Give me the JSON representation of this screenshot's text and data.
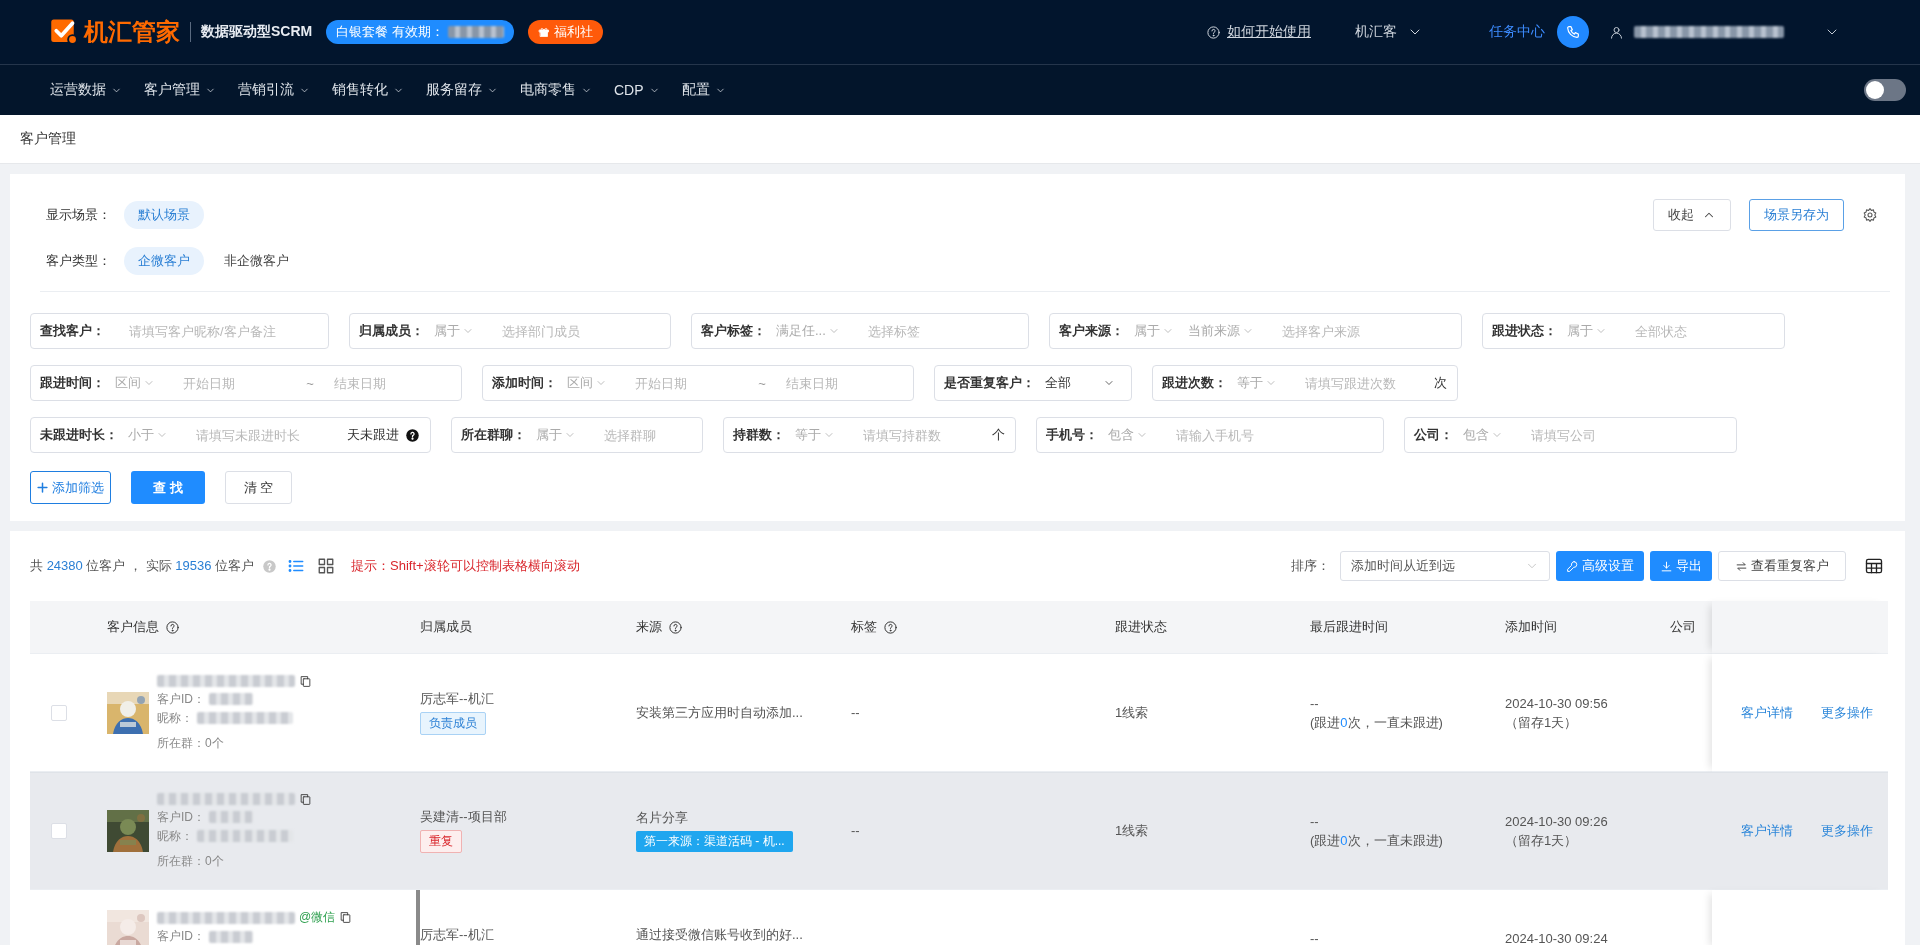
{
  "header": {
    "brand": "机汇管家",
    "product": "数据驱动型SCRM",
    "plan_badge": "白银套餐 有效期：",
    "welfare_badge": "福利社",
    "help_link": "如何开始使用",
    "org_menu": "机汇客",
    "task_center": "任务中心"
  },
  "nav": {
    "items": [
      {
        "label": "运营数据"
      },
      {
        "label": "客户管理"
      },
      {
        "label": "营销引流"
      },
      {
        "label": "销售转化"
      },
      {
        "label": "服务留存"
      },
      {
        "label": "电商零售"
      },
      {
        "label": "CDP"
      },
      {
        "label": "配置"
      }
    ],
    "toggle": {
      "on": false
    }
  },
  "breadcrumb": "客户管理",
  "scene_rows": [
    {
      "label": "显示场景：",
      "options": [
        {
          "label": "默认场景",
          "selected": true
        }
      ]
    },
    {
      "label": "客户类型：",
      "options": [
        {
          "label": "企微客户",
          "selected": true
        },
        {
          "label": "非企微客户",
          "selected": false
        }
      ]
    }
  ],
  "card_buttons": {
    "collapse": "收起",
    "save_scene": "场景另存为"
  },
  "filter_rows": [
    [
      {
        "label": "查找客户：",
        "parts": [
          {
            "kind": "input",
            "placeholder": "请填写客户昵称/客户备注"
          }
        ]
      },
      {
        "label": "归属成员：",
        "parts": [
          {
            "kind": "select",
            "value": "属于",
            "muted": true
          },
          {
            "kind": "input",
            "placeholder": "选择部门成员"
          }
        ]
      },
      {
        "label": "客户标签：",
        "parts": [
          {
            "kind": "select",
            "value": "满足任...",
            "muted": true
          },
          {
            "kind": "input",
            "placeholder": "选择标签"
          }
        ]
      },
      {
        "label": "客户来源：",
        "parts": [
          {
            "kind": "select",
            "value": "属于",
            "muted": true
          },
          {
            "kind": "select",
            "value": "当前来源",
            "muted": true
          },
          {
            "kind": "input",
            "placeholder": "选择客户来源"
          }
        ]
      },
      {
        "label": "跟进状态：",
        "parts": [
          {
            "kind": "select",
            "value": "属于",
            "muted": true
          },
          {
            "kind": "input",
            "placeholder": "全部状态"
          }
        ]
      }
    ],
    [
      {
        "label": "跟进时间：",
        "parts": [
          {
            "kind": "select",
            "value": "区间",
            "muted": true
          },
          {
            "kind": "input",
            "placeholder": "开始日期"
          },
          {
            "kind": "separator",
            "text": "~"
          },
          {
            "kind": "input",
            "placeholder": "结束日期"
          }
        ]
      },
      {
        "label": "添加时间：",
        "parts": [
          {
            "kind": "select",
            "value": "区间",
            "muted": true
          },
          {
            "kind": "input",
            "placeholder": "开始日期"
          },
          {
            "kind": "separator",
            "text": "~"
          },
          {
            "kind": "input",
            "placeholder": "结束日期"
          }
        ]
      },
      {
        "label": "是否重复客户：",
        "parts": [
          {
            "kind": "select",
            "value": "全部",
            "muted": false
          }
        ]
      },
      {
        "label": "跟进次数：",
        "parts": [
          {
            "kind": "select",
            "value": "等于",
            "muted": true
          },
          {
            "kind": "input",
            "placeholder": "请填写跟进次数"
          },
          {
            "kind": "unit",
            "text": "次"
          }
        ]
      }
    ],
    [
      {
        "label": "未跟进时长：",
        "parts": [
          {
            "kind": "select",
            "value": "小于",
            "muted": true
          },
          {
            "kind": "input",
            "placeholder": "请填写未跟进时长"
          },
          {
            "kind": "unit",
            "text": "天未跟进"
          },
          {
            "kind": "help"
          }
        ]
      },
      {
        "label": "所在群聊：",
        "parts": [
          {
            "kind": "select",
            "value": "属于",
            "muted": true
          },
          {
            "kind": "input",
            "placeholder": "选择群聊"
          }
        ]
      },
      {
        "label": "持群数：",
        "parts": [
          {
            "kind": "select",
            "value": "等于",
            "muted": true
          },
          {
            "kind": "input",
            "placeholder": "请填写持群数"
          },
          {
            "kind": "unit",
            "text": "个"
          }
        ]
      },
      {
        "label": "手机号：",
        "parts": [
          {
            "kind": "select",
            "value": "包含",
            "muted": true
          },
          {
            "kind": "input",
            "placeholder": "请输入手机号"
          }
        ]
      },
      {
        "label": "公司：",
        "parts": [
          {
            "kind": "select",
            "value": "包含",
            "muted": true
          },
          {
            "kind": "input",
            "placeholder": "请填写公司"
          }
        ]
      }
    ]
  ],
  "filter_buttons": {
    "add": "添加筛选",
    "search": "查 找",
    "clear": "清 空"
  },
  "summary": {
    "total_prefix": "共 ",
    "total": "24380",
    "total_suffix": " 位客户 ， 实际 ",
    "actual": "19536",
    "actual_suffix": " 位客户",
    "views": [
      {
        "kind": "list",
        "selected": true
      },
      {
        "kind": "grid",
        "selected": false
      }
    ],
    "tip": "提示：Shift+滚轮可以控制表格横向滚动"
  },
  "toolbar": {
    "sort_label": "排序：",
    "sort_value": "添加时间从近到远",
    "buttons": [
      {
        "kind": "advanced",
        "label": "高级设置"
      },
      {
        "kind": "export",
        "label": "导出"
      },
      {
        "kind": "duplicates",
        "label": "查看重复客户"
      }
    ]
  },
  "table": {
    "columns": [
      {
        "label": "客户信息",
        "help": true
      },
      {
        "label": "归属成员",
        "help": false
      },
      {
        "label": "来源",
        "help": true
      },
      {
        "label": "标签",
        "help": true
      },
      {
        "label": "跟进状态",
        "help": false
      },
      {
        "label": "最后跟进时间",
        "help": false
      },
      {
        "label": "添加时间",
        "help": false
      },
      {
        "label": "公司",
        "help": false
      }
    ],
    "rows": [
      {
        "checked": false,
        "highlighted": false,
        "id_label": "客户ID：",
        "nick_label": "昵称：",
        "group_label": "所在群：0个",
        "owner": "厉志军--机汇",
        "owner_tag": {
          "kind": "owner",
          "text": "负责成员"
        },
        "source": "安装第三方应用时自动添加...",
        "tags": "--",
        "status": "1线索",
        "last_follow": "--",
        "follow_note": [
          "(跟进",
          "0",
          "次，一直未跟进)"
        ],
        "added": "2024-10-30 09:56",
        "retention": "（留存1天）",
        "actions": [
          "客户详情",
          "更多操作"
        ]
      },
      {
        "checked": false,
        "highlighted": true,
        "id_label": "客户ID：",
        "nick_label": "昵称：",
        "group_label": "所在群：0个",
        "owner": "吴建清--项目部",
        "owner_tag": {
          "kind": "duplicate",
          "text": "重复"
        },
        "source": "名片分享",
        "source_tag": "第一来源：渠道活码 - 机...",
        "tags": "--",
        "status": "1线索",
        "last_follow": "--",
        "follow_note": [
          "(跟进",
          "0",
          "次，一直未跟进)"
        ],
        "added": "2024-10-30 09:26",
        "retention": "（留存1天）",
        "actions": [
          "客户详情",
          "更多操作"
        ]
      },
      {
        "highlighted": false,
        "name_suffix": "@微信",
        "id_label": "客户ID：",
        "owner": "厉志军--机汇",
        "source": "通过接受微信账号收到的好...",
        "last_follow": "--",
        "added": "2024-10-30 09:24"
      }
    ]
  }
}
